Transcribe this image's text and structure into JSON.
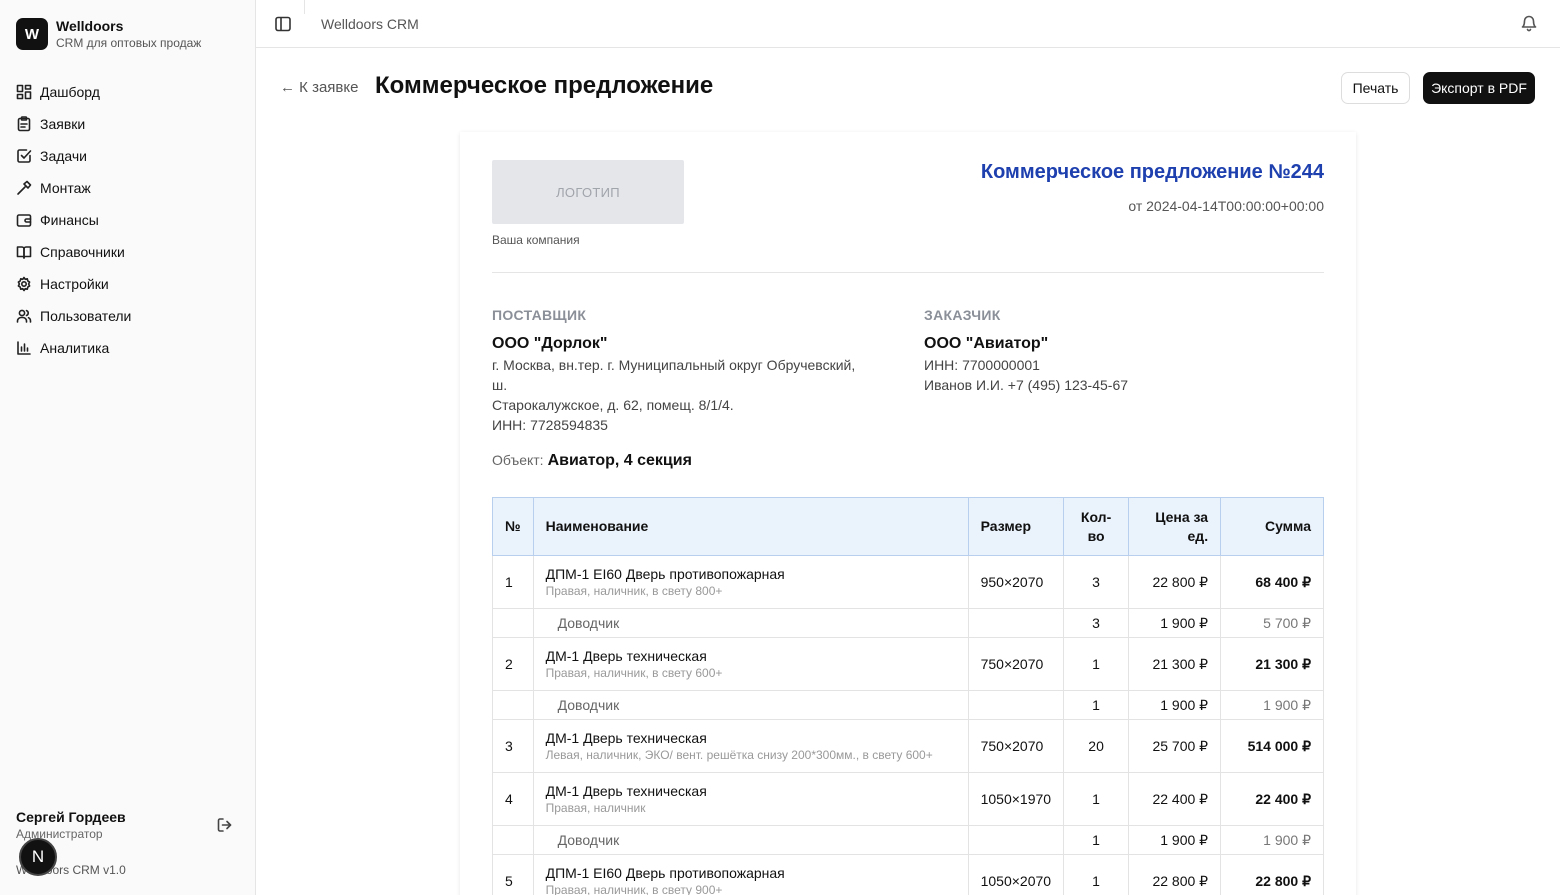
{
  "app": {
    "logo_letter": "W",
    "name": "Welldoors",
    "subtitle": "CRM для оптовых продаж",
    "breadcrumb": "Welldoors CRM"
  },
  "sidebar": {
    "items": [
      {
        "label": "Дашборд",
        "icon": "dashboard-icon"
      },
      {
        "label": "Заявки",
        "icon": "clipboard-icon"
      },
      {
        "label": "Задачи",
        "icon": "check-square-icon"
      },
      {
        "label": "Монтаж",
        "icon": "hammer-icon"
      },
      {
        "label": "Финансы",
        "icon": "wallet-icon"
      },
      {
        "label": "Справочники",
        "icon": "book-icon"
      },
      {
        "label": "Настройки",
        "icon": "gear-icon"
      },
      {
        "label": "Пользователи",
        "icon": "users-icon"
      },
      {
        "label": "Аналитика",
        "icon": "bar-chart-icon"
      }
    ],
    "user_name": "Сергей Гордеев",
    "user_role": "Администратор",
    "version": "Welldoors CRM v1.0",
    "badge": "N"
  },
  "header": {
    "back": "← К заявке",
    "title": "Коммерческое предложение",
    "print": "Печать",
    "export": "Экспорт в PDF"
  },
  "doc": {
    "logo_placeholder": "ЛОГОТИП",
    "company_caption": "Ваша компания",
    "title": "Коммерческое предложение №244",
    "date": "от 2024-04-14T00:00:00+00:00",
    "supplier": {
      "heading": "ПОСТАВЩИК",
      "name": "ООО \"Дорлок\"",
      "address1": "г. Москва, вн.тер. г. Муниципальный округ Обручевский, ш.",
      "address2": "Старокалужское, д. 62, помещ. 8/1/4.",
      "inn": "ИНН: 7728594835"
    },
    "customer": {
      "heading": "ЗАКАЗЧИК",
      "name": "ООО \"Авиатор\"",
      "inn": "ИНН: 7700000001",
      "contact": "Иванов И.И. +7 (495) 123-45-67"
    },
    "object_label": "Объект:",
    "object_value": "Авиатор, 4 секция",
    "table": {
      "headers": {
        "num": "№",
        "name": "Наименование",
        "size": "Размер",
        "qty_1": "Кол-",
        "qty_2": "во",
        "price_1": "Цена за",
        "price_2": "ед.",
        "sum": "Сумма"
      },
      "rows": [
        {
          "num": "1",
          "name": "ДПМ-1 EI60 Дверь противопожарная",
          "note": "Правая, наличник, в свету 800+",
          "size": "950×2070",
          "qty": "3",
          "price": "22 800 ₽",
          "sum": "68 400 ₽"
        },
        {
          "name": "Доводчик",
          "qty": "3",
          "price": "1 900 ₽",
          "sum": "5 700 ₽"
        },
        {
          "num": "2",
          "name": "ДМ-1 Дверь техническая",
          "note": "Правая, наличник, в свету 600+",
          "size": "750×2070",
          "qty": "1",
          "price": "21 300 ₽",
          "sum": "21 300 ₽"
        },
        {
          "name": "Доводчик",
          "qty": "1",
          "price": "1 900 ₽",
          "sum": "1 900 ₽"
        },
        {
          "num": "3",
          "name": "ДМ-1 Дверь техническая",
          "note": "Левая, наличник, ЭКО/ вент. решётка снизу 200*300мм., в свету 600+",
          "size": "750×2070",
          "qty": "20",
          "price": "25 700 ₽",
          "sum": "514 000 ₽"
        },
        {
          "num": "4",
          "name": "ДМ-1 Дверь техническая",
          "note": "Правая, наличник",
          "size": "1050×1970",
          "qty": "1",
          "price": "22 400 ₽",
          "sum": "22 400 ₽"
        },
        {
          "name": "Доводчик",
          "qty": "1",
          "price": "1 900 ₽",
          "sum": "1 900 ₽"
        },
        {
          "num": "5",
          "name": "ДПМ-1 EI60 Дверь противопожарная",
          "note": "Правая, наличник, в свету 900+",
          "size": "1050×2070",
          "qty": "1",
          "price": "22 800 ₽",
          "sum": "22 800 ₽"
        }
      ]
    }
  }
}
